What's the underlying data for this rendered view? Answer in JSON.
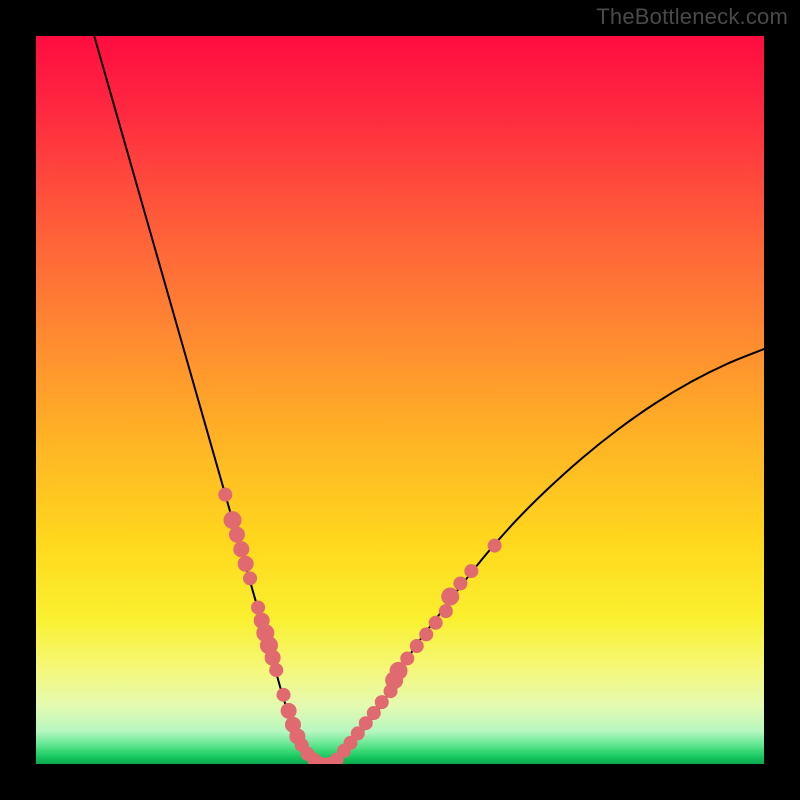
{
  "watermark": {
    "text": "TheBottleneck.com"
  },
  "chart_data": {
    "type": "line",
    "title": "",
    "xlabel": "",
    "ylabel": "",
    "xlim": [
      0,
      100
    ],
    "ylim": [
      0,
      100
    ],
    "grid": false,
    "legend": false,
    "background_gradient": {
      "stops": [
        {
          "pos": 0.0,
          "color": "#ff0c40"
        },
        {
          "pos": 0.1,
          "color": "#ff2840"
        },
        {
          "pos": 0.25,
          "color": "#ff5a3a"
        },
        {
          "pos": 0.4,
          "color": "#ff8632"
        },
        {
          "pos": 0.55,
          "color": "#ffb225"
        },
        {
          "pos": 0.7,
          "color": "#ffd91d"
        },
        {
          "pos": 0.8,
          "color": "#f9f02f"
        },
        {
          "pos": 0.87,
          "color": "#f5f87a"
        },
        {
          "pos": 0.92,
          "color": "#e4fab0"
        },
        {
          "pos": 0.955,
          "color": "#b6f7c0"
        },
        {
          "pos": 0.975,
          "color": "#5ae58c"
        },
        {
          "pos": 0.99,
          "color": "#17c85f"
        },
        {
          "pos": 1.0,
          "color": "#0aa84c"
        }
      ]
    },
    "series": [
      {
        "name": "curve",
        "stroke": "#000000",
        "x": [
          8,
          10,
          12,
          14,
          16,
          18,
          20,
          22,
          24,
          26,
          28,
          29,
          30,
          31,
          32,
          33,
          34,
          35,
          36,
          37,
          38,
          39,
          40,
          41,
          42,
          44,
          46,
          48,
          50,
          52,
          55,
          58,
          62,
          66,
          70,
          75,
          80,
          85,
          90,
          95,
          100
        ],
        "y": [
          100,
          93,
          86,
          79,
          72,
          65,
          58,
          51,
          44,
          37,
          30,
          26.5,
          23,
          19.5,
          16,
          12.5,
          9,
          6,
          3.5,
          1.5,
          0.5,
          0,
          0,
          0.5,
          1.5,
          3.5,
          6,
          9,
          12.5,
          16,
          20,
          24,
          29,
          33.5,
          37.5,
          42,
          46,
          49.5,
          52.5,
          55,
          57
        ]
      },
      {
        "name": "dots-left",
        "type": "scatter",
        "color": "#e06a6f",
        "r_default": 7,
        "points": [
          {
            "x": 26.0,
            "y": 37.0,
            "r": 7
          },
          {
            "x": 27.0,
            "y": 33.5,
            "r": 9
          },
          {
            "x": 27.6,
            "y": 31.5,
            "r": 8
          },
          {
            "x": 28.2,
            "y": 29.5,
            "r": 8
          },
          {
            "x": 28.8,
            "y": 27.5,
            "r": 8
          },
          {
            "x": 29.4,
            "y": 25.5,
            "r": 7
          },
          {
            "x": 30.5,
            "y": 21.5,
            "r": 7
          },
          {
            "x": 31.0,
            "y": 19.7,
            "r": 8
          },
          {
            "x": 31.5,
            "y": 18.0,
            "r": 9
          },
          {
            "x": 32.0,
            "y": 16.3,
            "r": 9
          },
          {
            "x": 32.5,
            "y": 14.6,
            "r": 8
          },
          {
            "x": 33.0,
            "y": 12.9,
            "r": 7
          },
          {
            "x": 34.0,
            "y": 9.5,
            "r": 7
          },
          {
            "x": 34.7,
            "y": 7.3,
            "r": 8
          },
          {
            "x": 35.3,
            "y": 5.4,
            "r": 8
          },
          {
            "x": 35.9,
            "y": 3.8,
            "r": 8
          },
          {
            "x": 36.5,
            "y": 2.6,
            "r": 7
          },
          {
            "x": 37.3,
            "y": 1.4,
            "r": 7
          },
          {
            "x": 38.2,
            "y": 0.6,
            "r": 7
          },
          {
            "x": 39.2,
            "y": 0.0,
            "r": 7
          },
          {
            "x": 40.3,
            "y": 0.0,
            "r": 7
          },
          {
            "x": 41.3,
            "y": 0.6,
            "r": 7
          }
        ]
      },
      {
        "name": "dots-right",
        "type": "scatter",
        "color": "#e06a6f",
        "r_default": 7,
        "points": [
          {
            "x": 42.3,
            "y": 1.8,
            "r": 7
          },
          {
            "x": 43.2,
            "y": 2.9,
            "r": 7
          },
          {
            "x": 44.2,
            "y": 4.2,
            "r": 7
          },
          {
            "x": 45.3,
            "y": 5.6,
            "r": 7
          },
          {
            "x": 46.4,
            "y": 7.0,
            "r": 7
          },
          {
            "x": 47.5,
            "y": 8.5,
            "r": 7
          },
          {
            "x": 48.7,
            "y": 10.0,
            "r": 7
          },
          {
            "x": 49.2,
            "y": 11.5,
            "r": 9
          },
          {
            "x": 49.8,
            "y": 12.8,
            "r": 9
          },
          {
            "x": 51.0,
            "y": 14.5,
            "r": 7
          },
          {
            "x": 52.3,
            "y": 16.2,
            "r": 7
          },
          {
            "x": 53.6,
            "y": 17.8,
            "r": 7
          },
          {
            "x": 54.9,
            "y": 19.4,
            "r": 7
          },
          {
            "x": 56.3,
            "y": 21.0,
            "r": 7
          },
          {
            "x": 56.9,
            "y": 23.0,
            "r": 9
          },
          {
            "x": 58.3,
            "y": 24.8,
            "r": 7
          },
          {
            "x": 59.8,
            "y": 26.5,
            "r": 7
          },
          {
            "x": 63.0,
            "y": 30.0,
            "r": 7
          }
        ]
      }
    ]
  }
}
